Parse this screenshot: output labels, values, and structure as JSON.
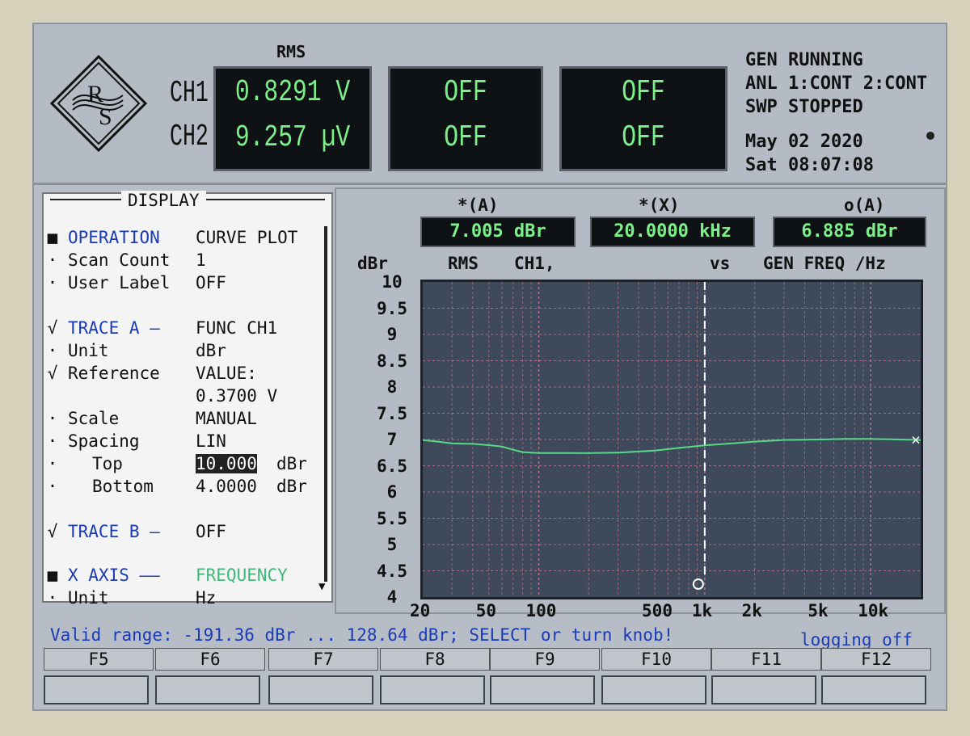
{
  "header": {
    "rms_label": "RMS",
    "ch1_label": "CH1",
    "ch2_label": "CH2",
    "ch1_value": "0.8291 V",
    "ch2_value": "9.257 µV",
    "meter2_top": "OFF",
    "meter2_bottom": "OFF",
    "meter3_top": "OFF",
    "meter3_bottom": "OFF",
    "logo_letters": "R&S"
  },
  "status": {
    "gen": "GEN RUNNING",
    "anl": "ANL 1:CONT 2:CONT",
    "swp": "SWP STOPPED",
    "date": "May 02 2020",
    "time": "Sat 08:07:08"
  },
  "panel": {
    "title": "DISPLAY",
    "rows": [
      {
        "mark": "■",
        "label": "OPERATION",
        "value": "CURVE PLOT",
        "style": "blue"
      },
      {
        "mark": "·",
        "label": "Scan Count",
        "value": "1"
      },
      {
        "mark": "·",
        "label": "User Label",
        "value": "OFF"
      },
      {
        "mark": "√",
        "label": "TRACE A —",
        "value": "FUNC CH1",
        "style": "blue"
      },
      {
        "mark": "·",
        "label": "Unit",
        "value": "dBr"
      },
      {
        "mark": "√",
        "label": "Reference",
        "value": "VALUE:"
      },
      {
        "mark": "",
        "label": "",
        "value": "0.3700 V"
      },
      {
        "mark": "·",
        "label": "Scale",
        "value": "MANUAL"
      },
      {
        "mark": "·",
        "label": "Spacing",
        "value": "LIN"
      },
      {
        "mark": "·",
        "label": "Top",
        "value": "10.000",
        "unit": "dBr"
      },
      {
        "mark": "·",
        "label": "Bottom",
        "value": "4.0000",
        "unit": "dBr"
      },
      {
        "mark": "√",
        "label": "TRACE B —",
        "value": "OFF",
        "style": "blue"
      },
      {
        "mark": "■",
        "label": "X AXIS ——",
        "value": "FREQUENCY",
        "style": "blue",
        "value_style": "green"
      },
      {
        "mark": "·",
        "label": "Unit",
        "value": "Hz"
      }
    ]
  },
  "markers": {
    "a_head": "*(A)",
    "a_value": "7.005 dBr",
    "x_head": "*(X)",
    "x_value": "20.0000 kHz",
    "o_head": "o(A)",
    "o_value": "6.885 dBr"
  },
  "graph_header": {
    "yunit": "dBr",
    "mode": "RMS",
    "channel": "CH1,",
    "vs": "vs",
    "xquantity": "GEN FREQ /Hz"
  },
  "chart_data": {
    "type": "line",
    "xscale": "log",
    "xlim": [
      20,
      20000
    ],
    "ylim": [
      4,
      10
    ],
    "yticks": [
      "10",
      "9.5",
      "9",
      "8.5",
      "8",
      "7.5",
      "7",
      "6.5",
      "6",
      "5.5",
      "5",
      "4.5",
      "4"
    ],
    "xticks": [
      "20",
      "50",
      "100",
      "500",
      "1k",
      "2k",
      "5k",
      "10k"
    ],
    "xtick_values": [
      20,
      50,
      100,
      500,
      1000,
      2000,
      5000,
      10000
    ],
    "grid": true,
    "cursor_x": 1000,
    "series": [
      {
        "color": "#57d98a",
        "x": [
          20,
          25,
          30,
          40,
          50,
          60,
          70,
          80,
          100,
          150,
          200,
          300,
          500,
          700,
          1000,
          1500,
          2000,
          3000,
          5000,
          7000,
          10000,
          15000,
          20000
        ],
        "y": [
          6.99,
          6.98,
          6.95,
          6.92,
          6.87,
          6.84,
          6.8,
          6.78,
          6.77,
          6.75,
          6.74,
          6.75,
          6.79,
          6.84,
          6.89,
          6.93,
          6.96,
          6.99,
          7.0,
          7.01,
          7.01,
          7.0,
          6.99
        ]
      }
    ]
  },
  "message": {
    "text": "Valid range: -191.36  dBr ...  128.64  dBr; SELECT or turn knob!",
    "logging": "logging off"
  },
  "fkeys": [
    "F5",
    "F6",
    "F7",
    "F8",
    "F9",
    "F10",
    "F11",
    "F12"
  ]
}
